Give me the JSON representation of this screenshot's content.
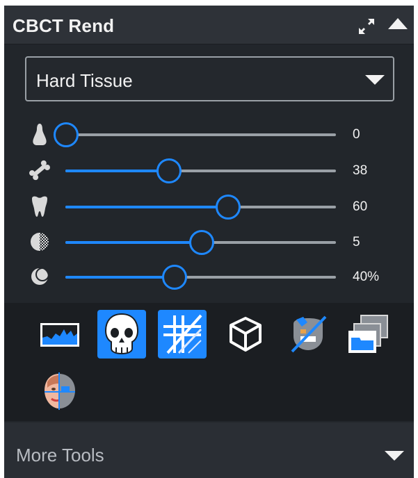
{
  "header": {
    "title": "CBCT Rend"
  },
  "preset": {
    "selected": "Hard Tissue"
  },
  "sliders": [
    {
      "icon": "soft-tissue-icon",
      "value_label": "0",
      "level": 0.0
    },
    {
      "icon": "bone-icon",
      "value_label": "38",
      "level": 0.38
    },
    {
      "icon": "tooth-icon",
      "value_label": "60",
      "level": 0.6
    },
    {
      "icon": "contrast-icon",
      "value_label": "5",
      "level": 0.5
    },
    {
      "icon": "opacity-icon",
      "value_label": "40%",
      "level": 0.4
    }
  ],
  "tools": [
    {
      "icon": "image-histogram-icon",
      "active": false
    },
    {
      "icon": "skull-icon",
      "active": true
    },
    {
      "icon": "slice-grid-icon",
      "active": true
    },
    {
      "icon": "3d-cube-icon",
      "active": false
    },
    {
      "icon": "mask-removal-icon",
      "active": false
    },
    {
      "icon": "window-stack-icon",
      "active": false
    },
    {
      "icon": "face-overlay-icon",
      "active": false
    }
  ],
  "more_tools": {
    "label": "More Tools"
  },
  "colors": {
    "accent": "#1e88ff",
    "panel_bg": "#22262b",
    "toolbar_bg": "#1b1e22"
  }
}
